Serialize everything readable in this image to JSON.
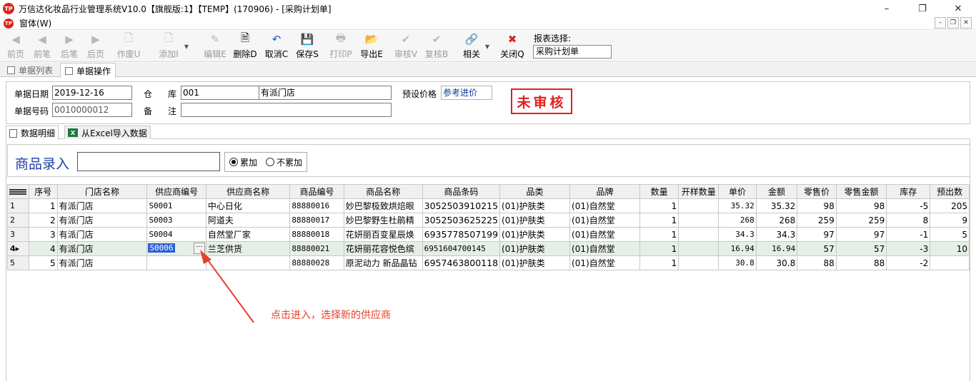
{
  "window": {
    "title": "万信达化妆品行业管理系统V10.0【旗舰版:1】【TEMP】(170906) - [采购计划单]",
    "logo_text": "TP",
    "controls": [
      "–",
      "❐",
      "✕"
    ]
  },
  "menubar": {
    "menu_label": "窗体(W)",
    "mdi_controls": [
      "–",
      "❐",
      "✕"
    ]
  },
  "toolbar": {
    "buttons": [
      {
        "label": "前页",
        "icon": "◀"
      },
      {
        "label": "前笔",
        "icon": "◀"
      },
      {
        "label": "后笔",
        "icon": "▶"
      },
      {
        "label": "后页",
        "icon": "▶"
      },
      {
        "label": "作废U",
        "icon": "🗋"
      },
      {
        "label": "添加I",
        "icon": "🗋"
      },
      {
        "label": "编辑E",
        "icon": "✎"
      },
      {
        "label": "删除D",
        "icon": "🗎"
      },
      {
        "label": "取消C",
        "icon": "↶"
      },
      {
        "label": "保存S",
        "icon": "💾"
      },
      {
        "label": "打印P",
        "icon": "🖶"
      },
      {
        "label": "导出E",
        "icon": "📂"
      },
      {
        "label": "审核V",
        "icon": "✔"
      },
      {
        "label": "复核B",
        "icon": "✔"
      },
      {
        "label": "相关",
        "icon": "🔗"
      },
      {
        "label": "关闭Q",
        "icon": "✖"
      }
    ],
    "report_label": "报表选择:",
    "report_value": "采购计划单"
  },
  "outer_tabs": [
    {
      "label": "单据列表"
    },
    {
      "label": "单据操作"
    }
  ],
  "form": {
    "date_label": "单据日期",
    "date_value": "2019-12-16",
    "number_label": "单据号码",
    "number_value": "0010000012",
    "warehouse_label_1": "仓",
    "warehouse_label_2": "库",
    "warehouse_code": "001",
    "warehouse_name": "有派门店",
    "remark_label_1": "备",
    "remark_label_2": "注",
    "remark_value": "",
    "price_label": "预设价格",
    "price_value": "参考进价",
    "status_stamp": "未审核"
  },
  "inner_tabs": [
    {
      "label": "数据明细"
    },
    {
      "label": "从Excel导入数据"
    }
  ],
  "entry": {
    "label": "商品录入",
    "value": "",
    "radio_accumulate": "累加",
    "radio_no_accumulate": "不累加",
    "selected": "累加"
  },
  "grid": {
    "columns": [
      "序号",
      "门店名称",
      "供应商编号",
      "供应商名称",
      "商品编号",
      "商品名称",
      "商品条码",
      "品类",
      "品牌",
      "数量",
      "开样数量",
      "单价",
      "金额",
      "零售价",
      "零售金额",
      "库存",
      "预出数"
    ],
    "rows": [
      {
        "ind": "1",
        "seq": "1",
        "store": "有派门店",
        "sup_code": "S0001",
        "sup_name": "中心日化",
        "code": "88880016",
        "name": "妙巴黎极致烘焙眼",
        "barcode": "3052503910215",
        "cat": "(01)护肤类",
        "brand": "(01)自然堂",
        "qty": "1",
        "sample": "",
        "price": "35.32",
        "amount": "35.32",
        "retail": "98",
        "retail_amt": "98",
        "stock": "-5",
        "pre": "205"
      },
      {
        "ind": "2",
        "seq": "2",
        "store": "有派门店",
        "sup_code": "S0003",
        "sup_name": "阿道夫",
        "code": "88880017",
        "name": "妙巴黎野生杜鹃精",
        "barcode": "3052503625225",
        "cat": "(01)护肤类",
        "brand": "(01)自然堂",
        "qty": "1",
        "sample": "",
        "price": "268",
        "amount": "268",
        "retail": "259",
        "retail_amt": "259",
        "stock": "8",
        "pre": "9"
      },
      {
        "ind": "3",
        "seq": "3",
        "store": "有派门店",
        "sup_code": "S0004",
        "sup_name": "自然堂厂家",
        "code": "88880018",
        "name": "花妍丽百变星辰焕",
        "barcode": "6935778507199",
        "cat": "(01)护肤类",
        "brand": "(01)自然堂",
        "qty": "1",
        "sample": "",
        "price": "34.3",
        "amount": "34.3",
        "retail": "97",
        "retail_amt": "97",
        "stock": "-1",
        "pre": "5"
      },
      {
        "ind": "4▸",
        "seq": "4",
        "store": "有派门店",
        "sup_code": "S0006",
        "sup_name": "兰芝供货",
        "code": "88880021",
        "name": "花妍丽花容悦色缤",
        "barcode": "6951604700145",
        "cat": "(01)护肤类",
        "brand": "(01)自然堂",
        "qty": "1",
        "sample": "",
        "price": "16.94",
        "amount": "16.94",
        "retail": "57",
        "retail_amt": "57",
        "stock": "-3",
        "pre": "10"
      },
      {
        "ind": "5",
        "seq": "5",
        "store": "有派门店",
        "sup_code": "",
        "sup_name": "",
        "code": "88880028",
        "name": "原泥动力 新品晶钻",
        "barcode": "6957463800118",
        "cat": "(01)护肤类",
        "brand": "(01)自然堂",
        "qty": "1",
        "sample": "",
        "price": "30.8",
        "amount": "30.8",
        "retail": "88",
        "retail_amt": "88",
        "stock": "-2",
        "pre": ""
      }
    ],
    "editor_button": "···"
  },
  "annotation": {
    "text": "点击进入，选择新的供应商",
    "color": "#e8402b"
  }
}
